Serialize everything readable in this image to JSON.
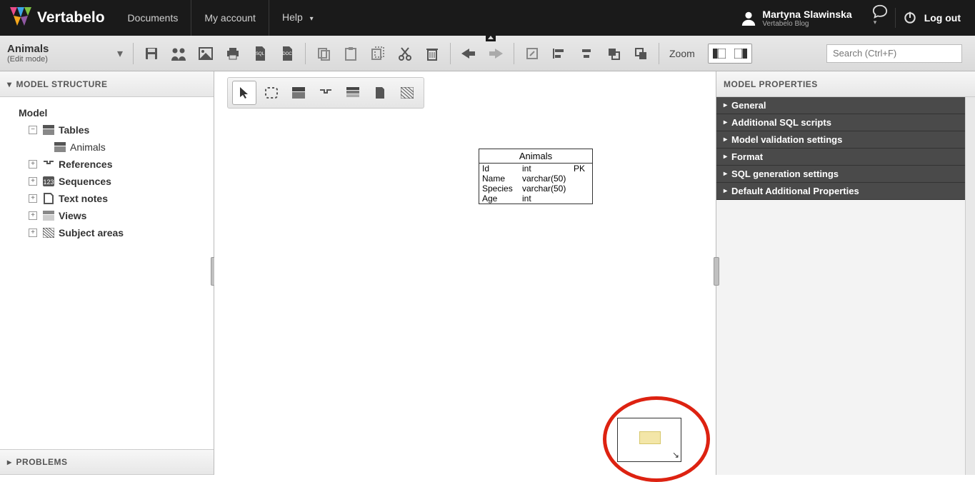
{
  "app": {
    "name": "Vertabelo"
  },
  "nav": {
    "links": [
      "Documents",
      "My account",
      "Help"
    ],
    "user_name": "Martyna Slawinska",
    "user_sub": "Vertabelo Blog",
    "logout": "Log out"
  },
  "document": {
    "title": "Animals",
    "mode": "(Edit mode)"
  },
  "toolbar": {
    "zoom_label": "Zoom"
  },
  "search": {
    "placeholder": "Search (Ctrl+F)"
  },
  "left_panel": {
    "structure_title": "MODEL STRUCTURE",
    "problems_title": "PROBLEMS",
    "root": "Model",
    "nodes": {
      "tables": "Tables",
      "animals": "Animals",
      "references": "References",
      "sequences": "Sequences",
      "textnotes": "Text notes",
      "views": "Views",
      "subjectareas": "Subject areas"
    }
  },
  "entity": {
    "name": "Animals",
    "columns": [
      {
        "name": "Id",
        "type": "int",
        "key": "PK"
      },
      {
        "name": "Name",
        "type": "varchar(50)",
        "key": ""
      },
      {
        "name": "Species",
        "type": "varchar(50)",
        "key": ""
      },
      {
        "name": "Age",
        "type": "int",
        "key": ""
      }
    ]
  },
  "right_panel": {
    "title": "MODEL PROPERTIES",
    "sections": [
      "General",
      "Additional SQL scripts",
      "Model validation settings",
      "Format",
      "SQL generation settings",
      "Default Additional Properties"
    ]
  }
}
